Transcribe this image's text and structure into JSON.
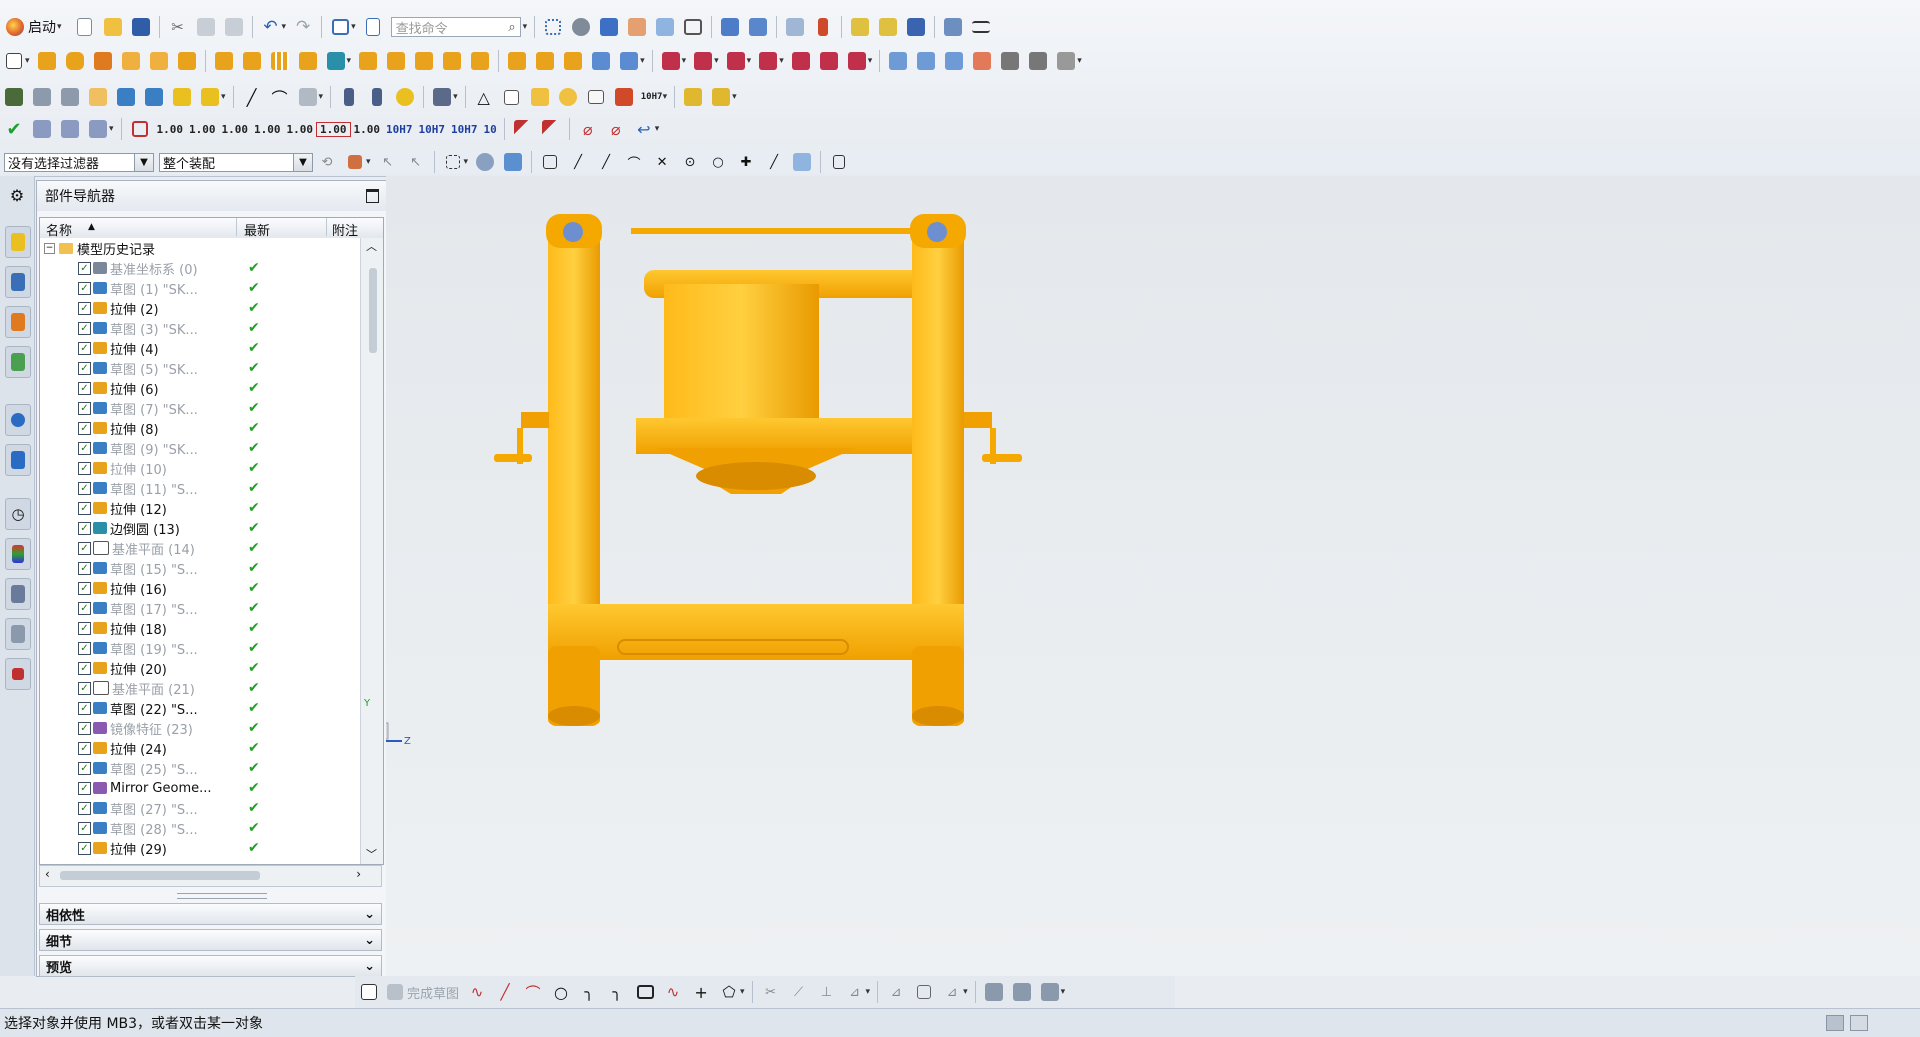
{
  "toolbar": {
    "start_label": "启动",
    "search_placeholder": "查找命令",
    "dim_labels": [
      "1.00",
      "1.00",
      "1.00",
      "1.00",
      "1.00",
      "1.00",
      "1.00",
      "10H7",
      "10H7",
      "10H7",
      "10"
    ]
  },
  "filter": {
    "selection_filter": "没有选择过滤器",
    "assembly_scope": "整个装配"
  },
  "navigator": {
    "title": "部件导航器",
    "columns": [
      "名称",
      "最新",
      "附注"
    ],
    "root": "模型历史记录",
    "items": [
      {
        "label": "基准坐标系 (0)",
        "type": "csys",
        "grey": true
      },
      {
        "label": "草图 (1) \"SK...",
        "type": "sketch",
        "grey": true
      },
      {
        "label": "拉伸 (2)",
        "type": "extrude",
        "grey": false
      },
      {
        "label": "草图 (3) \"SK...",
        "type": "sketch",
        "grey": true
      },
      {
        "label": "拉伸 (4)",
        "type": "extrude",
        "grey": false
      },
      {
        "label": "草图 (5) \"SK...",
        "type": "sketch",
        "grey": true
      },
      {
        "label": "拉伸 (6)",
        "type": "extrude",
        "grey": false
      },
      {
        "label": "草图 (7) \"SK...",
        "type": "sketch",
        "grey": true
      },
      {
        "label": "拉伸 (8)",
        "type": "extrude",
        "grey": false
      },
      {
        "label": "草图 (9) \"SK...",
        "type": "sketch",
        "grey": true
      },
      {
        "label": "拉伸 (10)",
        "type": "extrude",
        "grey": true
      },
      {
        "label": "草图 (11) \"S...",
        "type": "sketch",
        "grey": true
      },
      {
        "label": "拉伸 (12)",
        "type": "extrude",
        "grey": false
      },
      {
        "label": "边倒圆 (13)",
        "type": "blend",
        "grey": false
      },
      {
        "label": "基准平面 (14)",
        "type": "plane",
        "grey": true
      },
      {
        "label": "草图 (15) \"S...",
        "type": "sketch",
        "grey": true
      },
      {
        "label": "拉伸 (16)",
        "type": "extrude",
        "grey": false
      },
      {
        "label": "草图 (17) \"S...",
        "type": "sketch",
        "grey": true
      },
      {
        "label": "拉伸 (18)",
        "type": "extrude",
        "grey": false
      },
      {
        "label": "草图 (19) \"S...",
        "type": "sketch",
        "grey": true
      },
      {
        "label": "拉伸 (20)",
        "type": "extrude",
        "grey": false
      },
      {
        "label": "基准平面 (21)",
        "type": "plane",
        "grey": true
      },
      {
        "label": "草图 (22) \"S...",
        "type": "sketch",
        "grey": false
      },
      {
        "label": "镜像特征 (23)",
        "type": "mirror",
        "grey": true
      },
      {
        "label": "拉伸 (24)",
        "type": "extrude",
        "grey": false
      },
      {
        "label": "草图 (25) \"S...",
        "type": "sketch",
        "grey": true
      },
      {
        "label": "Mirror Geome...",
        "type": "mirror",
        "grey": false
      },
      {
        "label": "草图 (27) \"S...",
        "type": "sketch",
        "grey": true
      },
      {
        "label": "草图 (28) \"S...",
        "type": "sketch",
        "grey": true
      },
      {
        "label": "拉伸 (29)",
        "type": "extrude",
        "grey": false
      }
    ],
    "panels": [
      "相依性",
      "细节",
      "预览"
    ]
  },
  "viewport": {
    "model_color": "#f5a800",
    "model_shadow": "#d98c00",
    "triad_y": "Y",
    "triad_z": "Z"
  },
  "sketchbar": {
    "finish_sketch": "完成草图"
  },
  "status": {
    "message": "选择对象并使用 MB3，或者双击某一对象"
  },
  "colors": {
    "sketch_icon": "#3a7fc4",
    "extrude_icon": "#e9a21b",
    "check": "#22a022"
  }
}
